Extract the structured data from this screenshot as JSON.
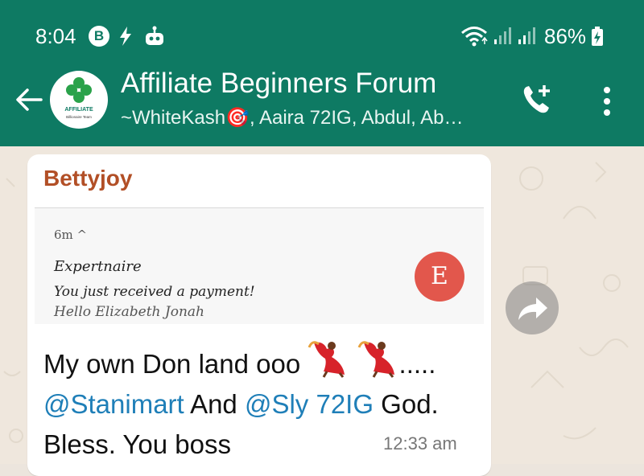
{
  "status_bar": {
    "time": "8:04",
    "b_badge": "B",
    "battery": "86%",
    "icons": [
      "b-app-icon",
      "bolt-icon",
      "robot-icon",
      "wifi-icon",
      "signal-icon",
      "signal-icon",
      "battery-charging-icon"
    ]
  },
  "header": {
    "title": "Affiliate Beginners Forum",
    "subtitle": "~WhiteKash🎯, Aaira 72IG, Abdul, Ab…",
    "avatar_label": "AFFILIATE",
    "avatar_sublabel": "Billionaire Team"
  },
  "message": {
    "sender": "Bettyjoy",
    "quoted": {
      "time": "6m ^",
      "app": "Expertnaire",
      "line1": "You just received a payment!",
      "line2": "Hello Elizabeth Jonah",
      "avatar_letter": "E"
    },
    "text_start": "My own Don land ooo ",
    "text_dots": ".....",
    "mention1": "@Stanimart",
    "text_mid": " And ",
    "mention2": "@Sly 72IG",
    "text_end": " God. Bless. You boss",
    "time": "12:33 am"
  },
  "colors": {
    "header_bg": "#0e7a63",
    "sender": "#b24f26",
    "mention": "#1f7fb8",
    "notif_avatar": "#e2574c"
  }
}
